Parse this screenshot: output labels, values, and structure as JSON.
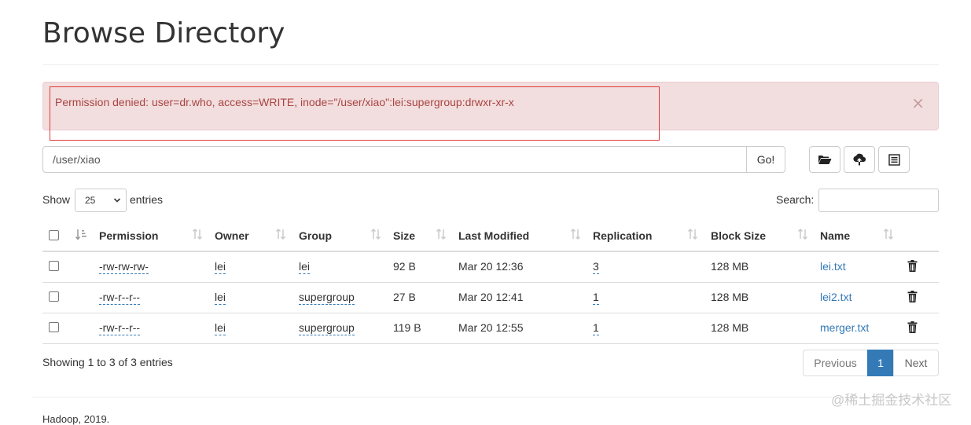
{
  "page": {
    "title": "Browse Directory"
  },
  "alert": {
    "message": "Permission denied: user=dr.who, access=WRITE, inode=\"/user/xiao\":lei:supergroup:drwxr-xr-x",
    "close": "×"
  },
  "toolbar": {
    "path_value": "/user/xiao",
    "go_label": "Go!",
    "icons": [
      "folder-open-icon",
      "upload-icon",
      "list-icon"
    ]
  },
  "entries": {
    "show_label": "Show",
    "selected": "25",
    "suffix_label": "entries"
  },
  "search": {
    "label": "Search:",
    "value": ""
  },
  "table": {
    "headers": {
      "permission": "Permission",
      "owner": "Owner",
      "group": "Group",
      "size": "Size",
      "last_modified": "Last Modified",
      "replication": "Replication",
      "block_size": "Block Size",
      "name": "Name"
    },
    "rows": [
      {
        "permission": "-rw-rw-rw-",
        "owner": "lei",
        "group": "lei",
        "size": "92 B",
        "last_modified": "Mar 20 12:36",
        "replication": "3",
        "block_size": "128 MB",
        "name": "lei.txt"
      },
      {
        "permission": "-rw-r--r--",
        "owner": "lei",
        "group": "supergroup",
        "size": "27 B",
        "last_modified": "Mar 20 12:41",
        "replication": "1",
        "block_size": "128 MB",
        "name": "lei2.txt"
      },
      {
        "permission": "-rw-r--r--",
        "owner": "lei",
        "group": "supergroup",
        "size": "119 B",
        "last_modified": "Mar 20 12:55",
        "replication": "1",
        "block_size": "128 MB",
        "name": "merger.txt"
      }
    ]
  },
  "info": {
    "showing": "Showing 1 to 3 of 3 entries"
  },
  "pagination": {
    "previous": "Previous",
    "current": "1",
    "next": "Next"
  },
  "footer": {
    "text": "Hadoop, 2019."
  },
  "watermark": "@稀土掘金技术社区",
  "colors": {
    "alert_bg": "#f2dede",
    "alert_text": "#a94442",
    "link": "#337ab7",
    "highlight": "#e03c3c"
  }
}
